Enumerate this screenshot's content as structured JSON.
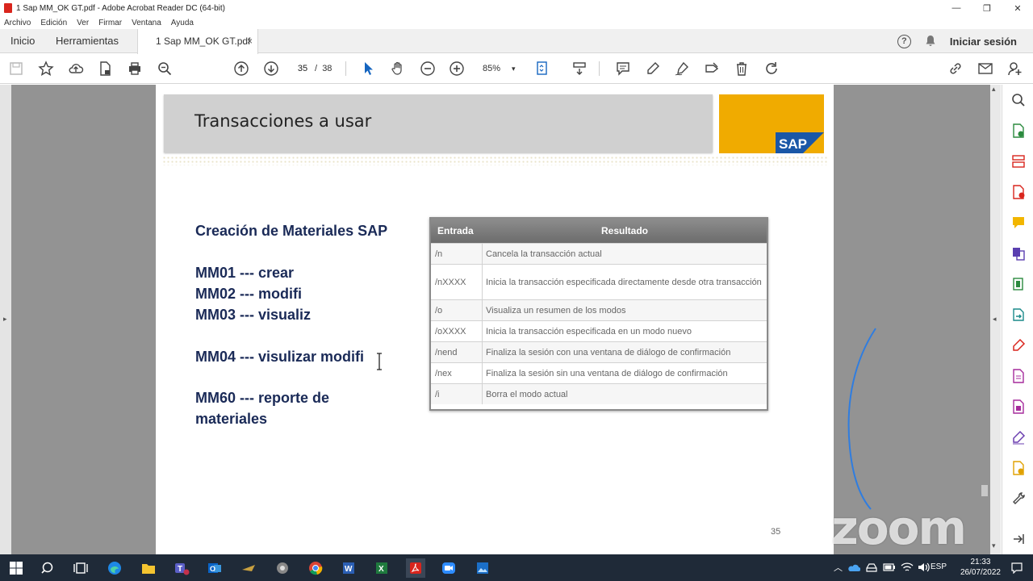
{
  "window": {
    "title": "1 Sap MM_OK GT.pdf - Adobe Acrobat Reader DC (64-bit)",
    "controls": {
      "minimize": "—",
      "restore": "❐",
      "close": "✕"
    }
  },
  "menu": [
    "Archivo",
    "Edición",
    "Ver",
    "Firmar",
    "Ventana",
    "Ayuda"
  ],
  "tabs": {
    "home": "Inicio",
    "tools": "Herramientas",
    "document": "1 Sap MM_OK GT.pdf",
    "close": "×"
  },
  "header_right": {
    "help": "?",
    "signin": "Iniciar sesión"
  },
  "toolbar": {
    "page_current": "35",
    "page_sep": "/",
    "page_total": "38",
    "zoom": "85%",
    "zoom_caret": "▾"
  },
  "slide": {
    "title": "Transacciones a usar",
    "logo": "SAP",
    "heading": "Creación de Materiales SAP",
    "lines": [
      "MM01 --- crear",
      "MM02 --- modifi",
      "MM03 --- visualiz",
      "MM04  --- visulizar modifi",
      "MM60 --- reporte de",
      "materiales"
    ],
    "page_number": "35"
  },
  "table": {
    "headers": [
      "Entrada",
      "Resultado"
    ],
    "rows": [
      {
        "entry": "/n",
        "result": "Cancela la transacción actual"
      },
      {
        "entry": "/nXXXX",
        "result": "Inicia la transacción especificada directamente desde otra transacción"
      },
      {
        "entry": "/o",
        "result": "Visualiza un resumen de los modos"
      },
      {
        "entry": "/oXXXX",
        "result": "Inicia la transacción especificada en un modo nuevo"
      },
      {
        "entry": "/nend",
        "result": "Finaliza la sesión con una ventana de diálogo de confirmación"
      },
      {
        "entry": "/nex",
        "result": "Finaliza la sesión sin una ventana de diálogo de confirmación"
      },
      {
        "entry": "/i",
        "result": "Borra el modo actual"
      }
    ]
  },
  "taskbar": {
    "lang": "ESP",
    "time": "21:33",
    "date": "26/07/2022"
  },
  "watermark": "zoom",
  "colors": {
    "sap_orange": "#f0ab00",
    "slide_text": "#1a2a57",
    "taskbar": "#1f2a38",
    "pdf_red": "#d9251d"
  }
}
